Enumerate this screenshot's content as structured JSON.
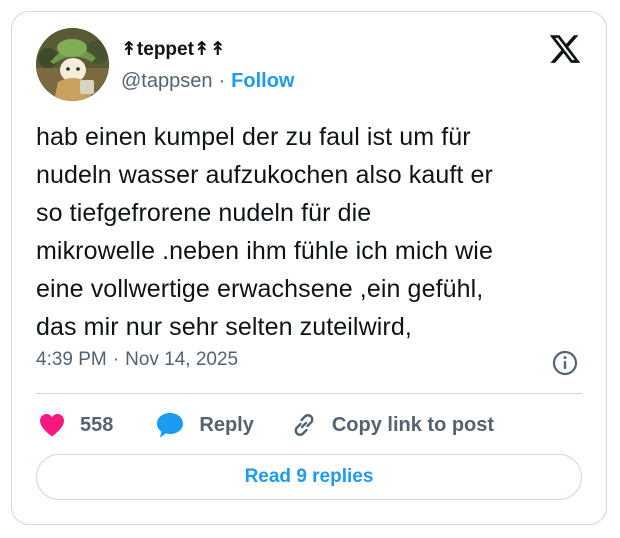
{
  "author": {
    "display_name": "↟teppet↟↟",
    "handle": "@tappsen",
    "separator": "·",
    "follow_label": "Follow"
  },
  "tweet": {
    "text": "hab einen kumpel der zu faul ist um für\nnudeln wasser aufzukochen also kauft er\nso tiefgefrorene nudeln für die\nmikrowelle .neben ihm fühle ich mich wie\neine vollwertige erwachsene ,ein gefühl,\ndas mir nur sehr selten zuteilwird,",
    "time": "4:39 PM",
    "separator": "·",
    "date": "Nov 14, 2025"
  },
  "actions": {
    "like_count": "558",
    "reply_label": "Reply",
    "copy_label": "Copy link to post"
  },
  "read_replies_label": "Read 9 replies",
  "colors": {
    "accent": "#1d9bf0",
    "like": "#f91880",
    "text": "#0f1419",
    "secondary": "#536471",
    "border": "#cfd9de"
  },
  "icons": {
    "logo": "x-logo-icon",
    "info": "info-icon",
    "like": "heart-icon",
    "reply": "speech-bubble-icon",
    "copy": "link-icon"
  }
}
